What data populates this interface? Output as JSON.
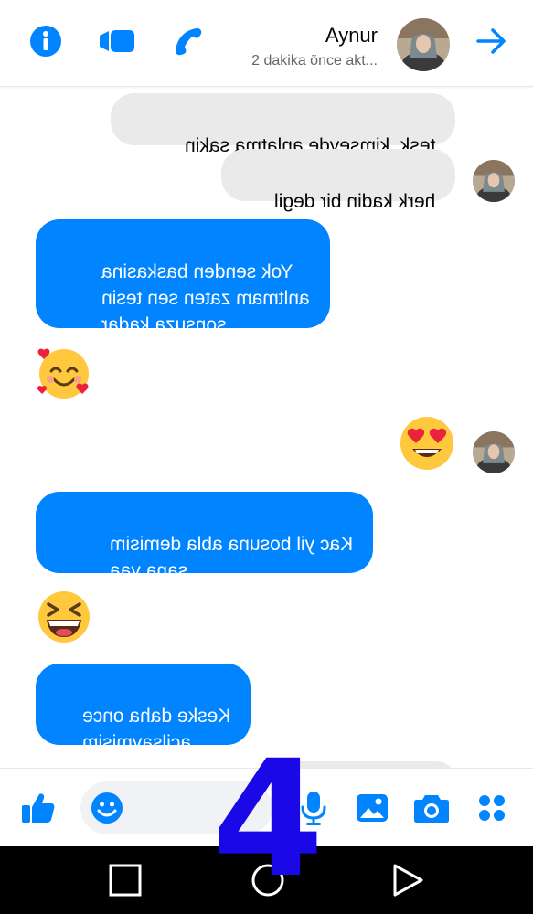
{
  "header": {
    "contact_name": "Aynur",
    "status": "2 dakika önce akt...",
    "icons": [
      "info-icon",
      "video-call-icon",
      "phone-icon",
      "forward-arrow-icon"
    ]
  },
  "messages": [
    {
      "type": "received",
      "text": "tesk. kimseyde anlatma sakin"
    },
    {
      "type": "received",
      "text": "herk kadin bir degil"
    },
    {
      "type": "sent",
      "text": "Yok senden baskasina\nanltmam zaten sen tesin\nsonsuza kadar"
    },
    {
      "type": "sent_emoji",
      "emoji": "smiling-face-with-hearts"
    },
    {
      "type": "received_emoji",
      "emoji": "heart-eyes"
    },
    {
      "type": "sent",
      "text": "Kac yil bosuna abla demisim\nsana yaa"
    },
    {
      "type": "sent_emoji",
      "emoji": "grinning-squinting-face"
    },
    {
      "type": "sent",
      "text": "Keske daha once\nacilsaymisim"
    }
  ],
  "composer": {
    "icons": [
      "like-icon",
      "emoji-icon",
      "microphone-icon",
      "gallery-icon",
      "camera-icon",
      "more-apps-icon"
    ]
  },
  "navbar": {
    "icons": [
      "recents-square-icon",
      "home-circle-icon",
      "back-triangle-icon"
    ]
  },
  "overlay": {
    "number": "4"
  },
  "colors": {
    "accent": "#0084ff",
    "received_bubble": "#eaeaea",
    "overlay": "#1a08e6"
  }
}
